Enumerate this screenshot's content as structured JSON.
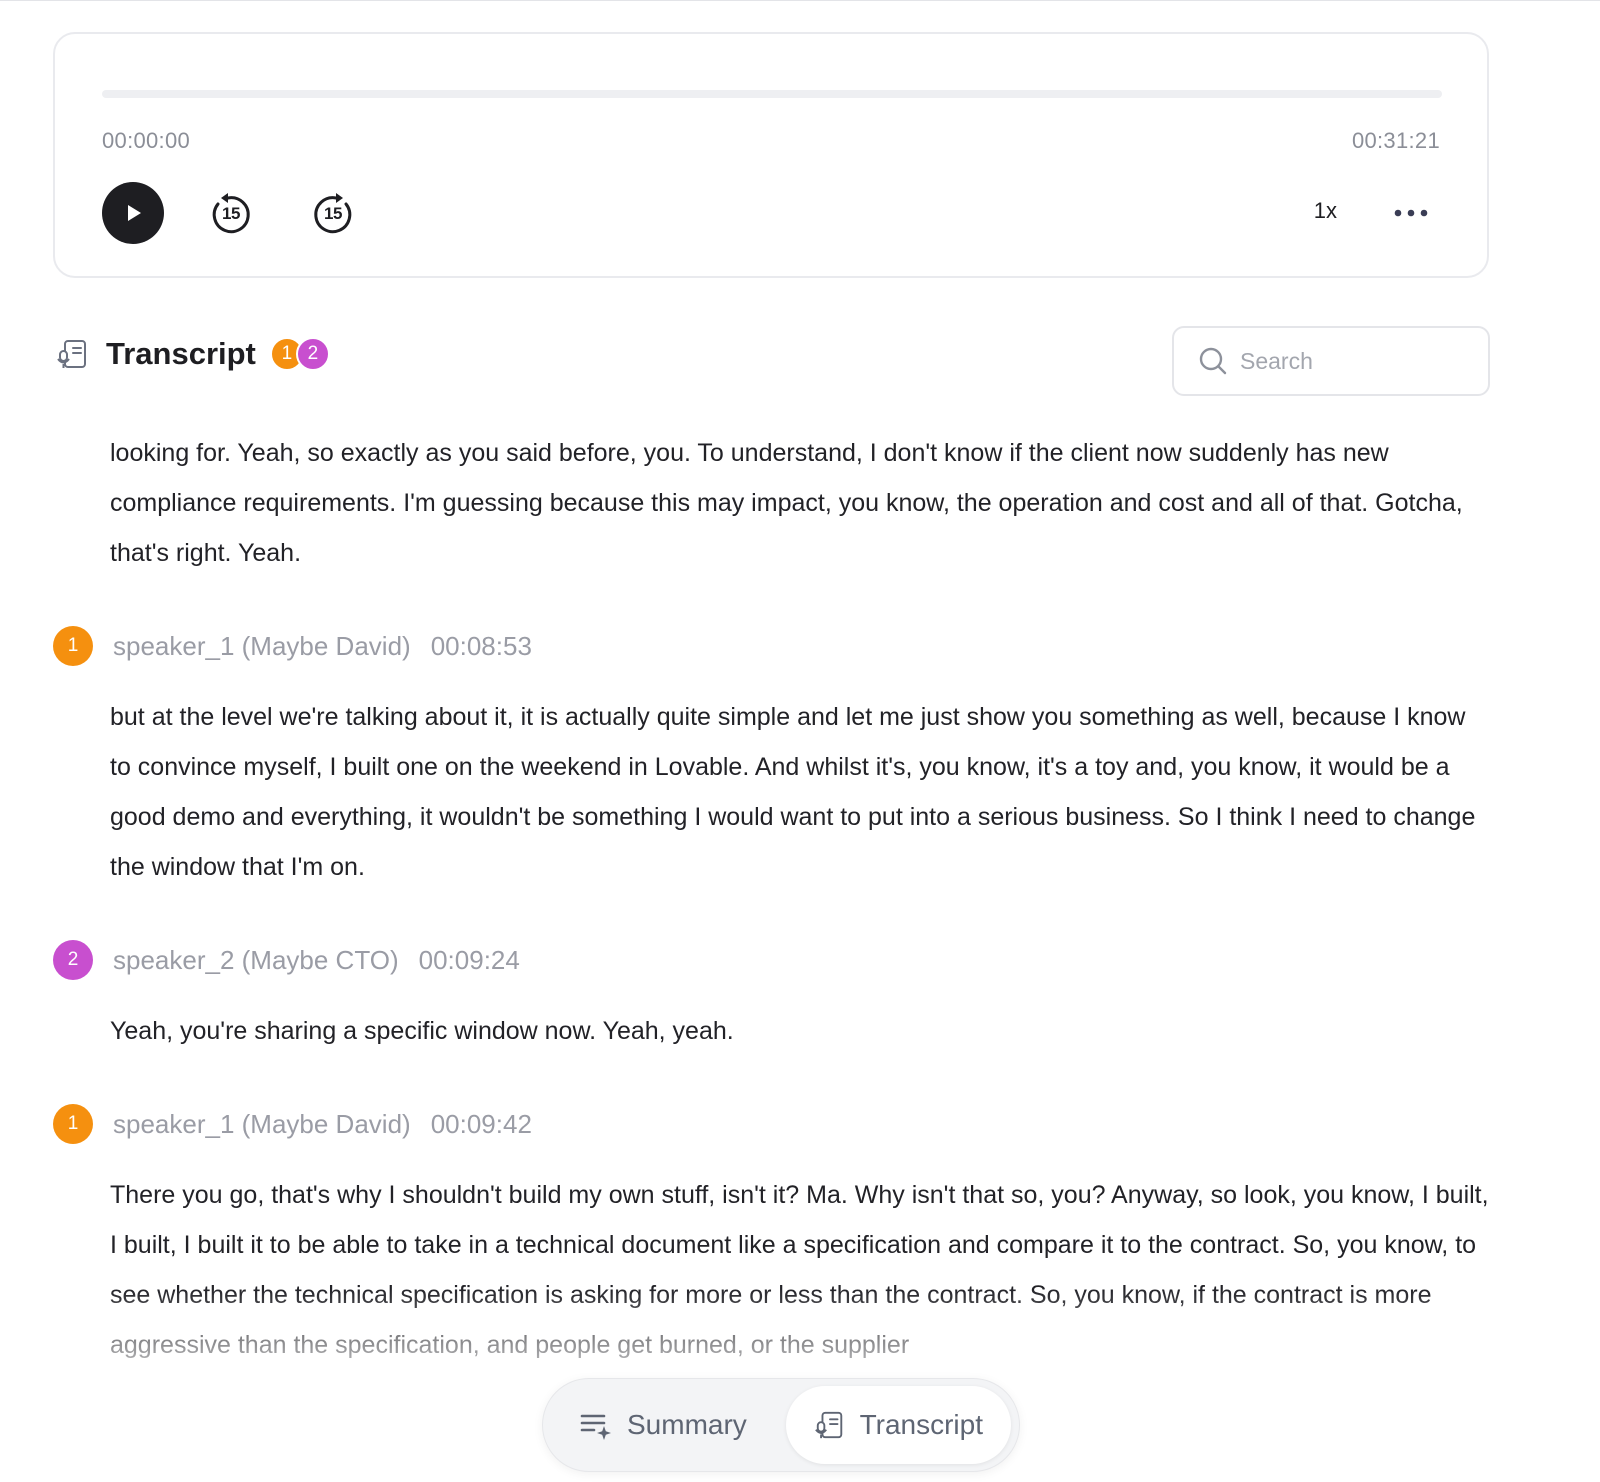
{
  "player": {
    "current_time": "00:00:00",
    "total_time": "00:31:21",
    "progress_fraction": 0,
    "skip_back_seconds": "15",
    "skip_forward_seconds": "15",
    "speed": "1x"
  },
  "transcript": {
    "title": "Transcript",
    "speaker_badges": [
      "1",
      "2"
    ],
    "search_placeholder": "Search",
    "intro_text": "looking for. Yeah, so exactly as you said before, you. To understand, I don't know if the client now suddenly has new compliance requirements. I'm guessing because this may impact, you know, the operation and cost and all of that. Gotcha, that's right. Yeah.",
    "segments": [
      {
        "speaker_number": "1",
        "speaker": "speaker_1 (Maybe David)",
        "timestamp": "00:08:53",
        "text": "but at the level we're talking about it, it is actually quite simple and let me just show you something as well, because I know to convince myself, I built one on the weekend in Lovable. And whilst it's, you know, it's a toy and, you know, it would be a good demo and everything, it wouldn't be something I would want to put into a serious business. So I think I need to change the window that I'm on."
      },
      {
        "speaker_number": "2",
        "speaker": "speaker_2 (Maybe CTO)",
        "timestamp": "00:09:24",
        "text": "Yeah, you're sharing a specific window now. Yeah, yeah."
      },
      {
        "speaker_number": "1",
        "speaker": "speaker_1 (Maybe David)",
        "timestamp": "00:09:42",
        "text": "There you go, that's why I shouldn't build my own stuff, isn't it? Ma. Why isn't that so, you? Anyway, so look, you know, I built, I built, I built it to be able to take in a technical document like a specification and compare it to the contract. So, you know, to see whether the technical specification is asking for more or less than the contract. So, you know, if the contract is more aggressive than the specification, and people get burned, or the supplier"
      }
    ]
  },
  "tabs": {
    "summary_label": "Summary",
    "transcript_label": "Transcript",
    "active": "transcript"
  },
  "colors": {
    "speaker_1": "#f5900f",
    "speaker_2": "#c84fcf"
  },
  "icons": {
    "play": "play-icon",
    "skip_back": "rewind-15-icon",
    "skip_forward": "forward-15-icon",
    "more": "more-horizontal-icon",
    "transcript": "transcript-icon",
    "search": "search-icon",
    "summary": "summary-icon"
  }
}
